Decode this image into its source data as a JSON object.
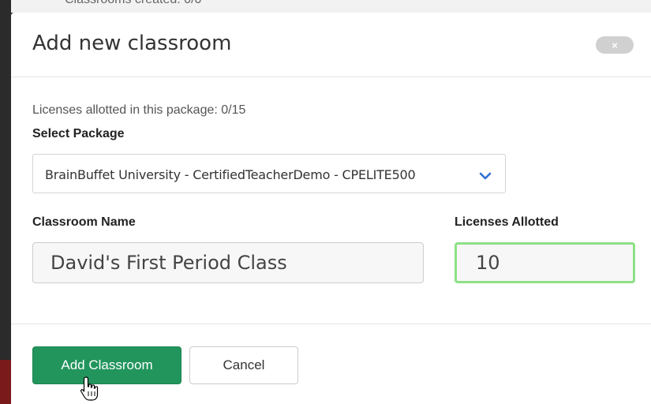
{
  "backdrop": {
    "partial_text": "Classrooms created: 0/0"
  },
  "modal": {
    "title": "Add new classroom",
    "close_label": "×",
    "licenses_info": "Licenses allotted in this package: 0/15",
    "select_package_label": "Select Package",
    "package_selected": "BrainBuffet University - CertifiedTeacherDemo - CPELITE500",
    "classroom_name_label": "Classroom Name",
    "classroom_name_value": "David's First Period Class",
    "licenses_allotted_label": "Licenses Allotted",
    "licenses_allotted_value": "10",
    "add_button_label": "Add Classroom",
    "cancel_button_label": "Cancel"
  },
  "colors": {
    "primary_button": "#22955d",
    "focus_border": "#8ee086",
    "chevron": "#2f6fd1"
  },
  "icons": {
    "close": "close-icon",
    "chevron": "chevron-down-icon",
    "cursor": "hand-pointer-icon"
  }
}
